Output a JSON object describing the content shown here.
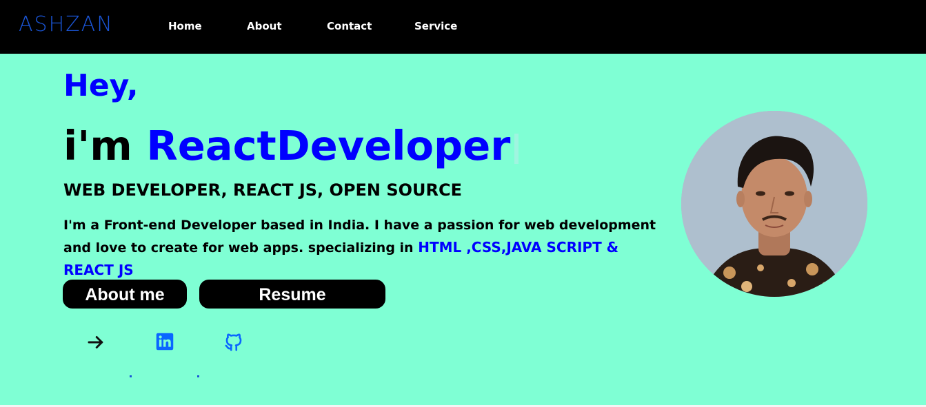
{
  "brand": "ASHZAN",
  "nav": {
    "home": "Home",
    "about": "About",
    "contact": "Contact",
    "service": "Service"
  },
  "hero": {
    "greeting": "Hey,",
    "prefix": "i'm",
    "role": "ReactDeveloper",
    "subtitle": "WEB DEVELOPER, REACT JS, OPEN SOURCE",
    "bio": "I'm a Front-end Developer based in India. I have a passion for web development and love to create for web apps. specializing in",
    "skills": "HTML ,CSS,JAVA SCRIPT & REACT JS"
  },
  "buttons": {
    "about": "About me",
    "resume": "Resume"
  },
  "social": [
    {
      "icon": "arrow-right-icon",
      "color": "#111111"
    },
    {
      "icon": "linkedin-icon",
      "color": "#0a66ff"
    },
    {
      "icon": "github-icon",
      "color": "#0a66ff"
    }
  ],
  "colors": {
    "background": "#7fffd4",
    "navbar": "#000000",
    "accent": "#0000ff",
    "brand": "#1a55d6"
  }
}
